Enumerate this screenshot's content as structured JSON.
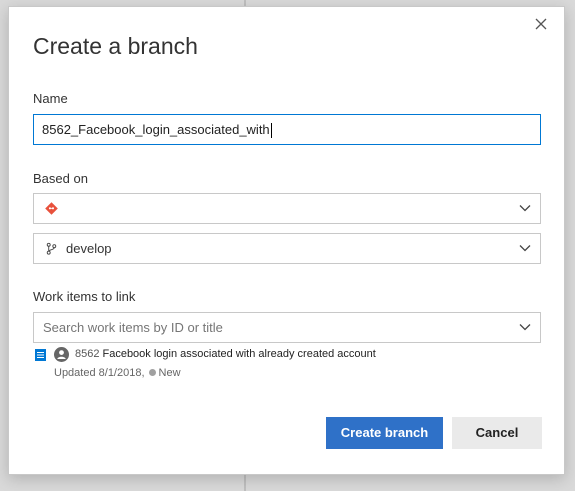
{
  "dialog": {
    "title": "Create a branch",
    "close_icon": "close-icon"
  },
  "name_field": {
    "label": "Name",
    "value": "8562_Facebook_login_associated_with"
  },
  "based_on": {
    "label": "Based on",
    "repository": {
      "icon": "git-repo-icon",
      "value": ""
    },
    "branch": {
      "icon": "branch-icon",
      "value": "develop"
    }
  },
  "work_items": {
    "label": "Work items to link",
    "search_placeholder": "Search work items by ID or title",
    "items": [
      {
        "id": "8562",
        "title": "Facebook login associated with already created account",
        "updated": "Updated 8/1/2018,",
        "state": "New",
        "type_icon": "user-story-icon",
        "avatar_icon": "avatar-icon"
      }
    ]
  },
  "actions": {
    "create_label": "Create branch",
    "cancel_label": "Cancel"
  },
  "colors": {
    "primary": "#2f71c8",
    "focus_border": "#0078d4",
    "git_icon": "#e8513c",
    "work_item_blue": "#0078d4",
    "state_dot": "#a0a0a0"
  }
}
